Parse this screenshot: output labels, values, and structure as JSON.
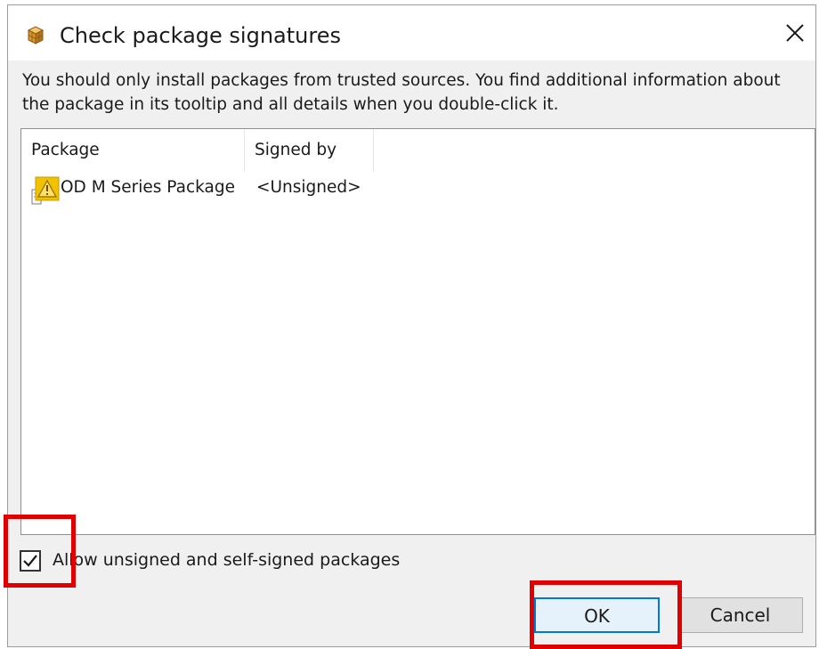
{
  "dialog": {
    "title": "Check package signatures",
    "title_icon": "package-cube-icon",
    "close_icon": "close-icon",
    "description": "You should only install packages from trusted sources. You find additional information about the package in its tooltip and all details when you double-click it."
  },
  "list": {
    "columns": [
      "Package",
      "Signed by"
    ],
    "rows": [
      {
        "package": "OD M Series Package",
        "signed_by": "<Unsigned>",
        "icon": "warning-package-icon"
      }
    ]
  },
  "options": {
    "allow_unsigned_label": "Allow unsigned and self-signed packages",
    "allow_unsigned_checked": true
  },
  "buttons": {
    "ok": "OK",
    "cancel": "Cancel"
  },
  "colors": {
    "highlight": "#e00000",
    "focus_border": "#0078d7",
    "warning": "#f2c200"
  }
}
